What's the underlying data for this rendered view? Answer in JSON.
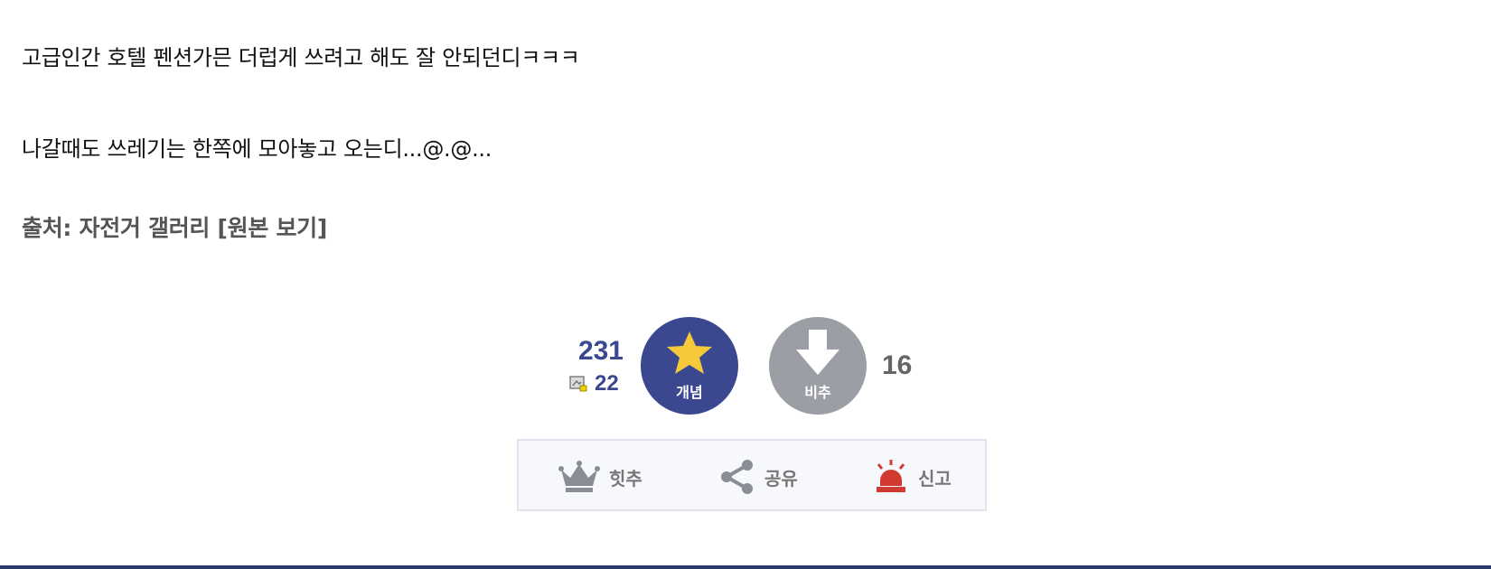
{
  "post": {
    "line1": "고급인간 호텔 펜션가믄 더럽게 쓰려고 해도 잘 안되던디ㅋㅋㅋ",
    "line2": "나갈때도 쓰레기는 한쪽에 모아놓고 오는디...@.@...",
    "source_prefix": "출처: 자전거 갤러리 ",
    "source_link": "[원본 보기]"
  },
  "votes": {
    "up_count": "231",
    "fix_count": "22",
    "up_label": "개념",
    "down_label": "비추",
    "down_count": "16"
  },
  "actions": {
    "hit_label": "힛추",
    "share_label": "공유",
    "report_label": "신고"
  },
  "colors": {
    "up": "#3b4890",
    "down": "#9c9ea6",
    "star": "#f5c93a",
    "report": "#d03a30"
  }
}
